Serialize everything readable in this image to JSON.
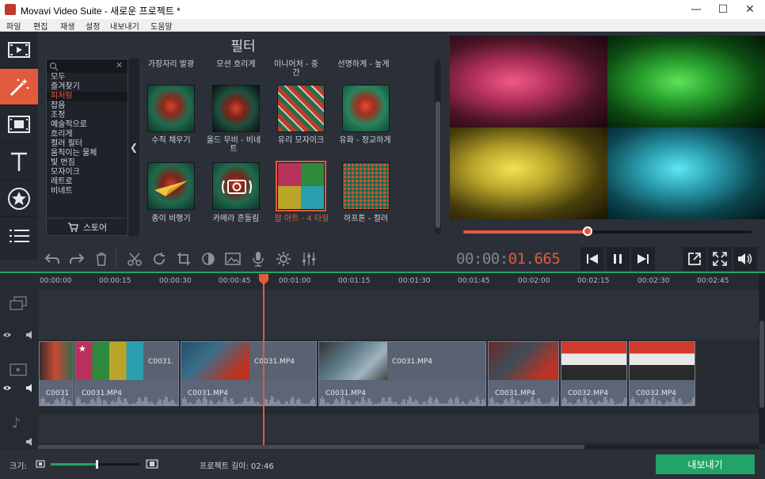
{
  "window": {
    "title": "Movavi Video Suite - 새로운 프로젝트 *",
    "minimize": "—",
    "maximize": "☐",
    "close": "✕"
  },
  "menu": [
    "파일",
    "편집",
    "재생",
    "설정",
    "내보내기",
    "도움말"
  ],
  "sidebar": {
    "tools": [
      "import-icon",
      "filters-icon",
      "transitions-icon",
      "titles-icon",
      "stickers-icon",
      "more-icon"
    ],
    "active": "filters-icon"
  },
  "filters_panel": {
    "title": "필터",
    "search_placeholder": "",
    "categories": [
      "모두",
      "즐겨찾기",
      "피처링",
      "잡음",
      "조정",
      "예술적으로",
      "흐리게",
      "컬러 필터",
      "움직이는 물체",
      "빛 번짐",
      "모자이크",
      "레트로",
      "비네트"
    ],
    "selected_category": "피처링",
    "store_label": "스토어",
    "column_headers": [
      "가장자리 발광",
      "모션 흐리게",
      "미니어처 - 중간",
      "선명하게 - 높게"
    ],
    "items": [
      {
        "label": "수직 채우기",
        "selected": false
      },
      {
        "label": "올드 무비 - 비네트",
        "selected": false
      },
      {
        "label": "유리 모자이크",
        "selected": false
      },
      {
        "label": "유화 - 정교하게",
        "selected": false
      },
      {
        "label": "종이 비행기",
        "selected": false
      },
      {
        "label": "카메라 흔들림",
        "selected": false
      },
      {
        "label": "팝 아트 - 4 타일",
        "selected": true
      },
      {
        "label": "하프톤 - 컬러",
        "selected": false
      }
    ]
  },
  "preview": {
    "progress_fraction": 0.43,
    "timecode_dim": "00:00:",
    "timecode_hi": "01.665"
  },
  "toolbar": [
    "undo-icon",
    "redo-icon",
    "delete-icon",
    "cut-icon",
    "rotate-icon",
    "crop-icon",
    "color-adjust-icon",
    "image-icon",
    "mic-icon",
    "settings-icon",
    "equalizer-icon"
  ],
  "player_controls": [
    "skip-back-icon",
    "pause-icon",
    "skip-forward-icon"
  ],
  "view_controls": [
    "popout-icon",
    "fullscreen-icon",
    "volume-icon"
  ],
  "timeline": {
    "ticks": [
      "00:00:00",
      "00:00:15",
      "00:00:30",
      "00:00:45",
      "00:01:00",
      "00:01:15",
      "00:01:30",
      "00:01:45",
      "00:02:00",
      "00:02:15",
      "00:02:30",
      "00:02:45"
    ],
    "clips": [
      {
        "video_name": "",
        "audio_name": "C0031"
      },
      {
        "video_name": "C0031.",
        "audio_name": "C0031.MP4"
      },
      {
        "video_name": "C0031.MP4",
        "audio_name": "C0031.MP4"
      },
      {
        "video_name": "C0031.MP4",
        "audio_name": "C0031.MP4"
      },
      {
        "video_name": "",
        "audio_name": "C0031.MP4"
      },
      {
        "video_name": "",
        "audio_name": "C0032.MP4"
      },
      {
        "video_name": "",
        "audio_name": "C0032.MP4"
      }
    ]
  },
  "bottom": {
    "zoom_label": "크기:",
    "zoom_fraction": 0.52,
    "project_length_label": "프로젝트 길이: 02:46",
    "export_label": "내보내기"
  }
}
